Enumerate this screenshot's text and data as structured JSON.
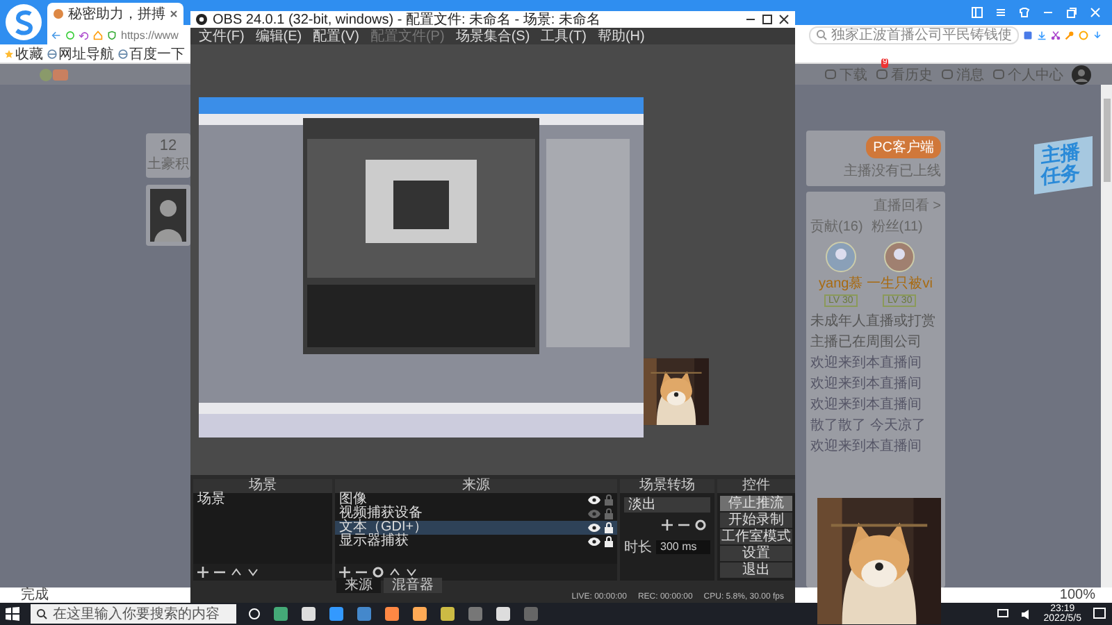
{
  "browser": {
    "tabs": [
      {
        "title": "秘密助力，拼搏",
        "selected": true
      }
    ],
    "address": "https://www",
    "search": {
      "placeholder": "独家正波首播公司平民铸钱使"
    },
    "bookmarks": [
      "收藏",
      "网址导航",
      "百度一下"
    ],
    "site_nav": [
      {
        "label": "下载"
      },
      {
        "label": "看历史",
        "badge": "9"
      },
      {
        "label": "消息"
      },
      {
        "label": "个人中心"
      }
    ],
    "score_card": {
      "value": "12",
      "label": "土豪积"
    },
    "side_panel": {
      "client_button": "PC客户端",
      "status": "主播没有已上线",
      "replay_link": "直播回看 >",
      "tabs": [
        {
          "label": "贡献(16)",
          "selected": false
        },
        {
          "label": "粉丝(11)",
          "selected": false
        }
      ],
      "fans": [
        {
          "name": "yang慕",
          "level": "LV 30"
        },
        {
          "name": "一生只被vi",
          "level": "LV 30"
        }
      ],
      "notice": [
        "未成年人直播或打赏",
        "主播已在周围公司"
      ],
      "chat": [
        "欢迎来到本直播间",
        "欢迎来到本直播间",
        "欢迎来到本直播间",
        "散了散了 今天凉了",
        "欢迎来到本直播间"
      ]
    },
    "promo": "主播任务",
    "status_text": "完成",
    "zoom": "100%"
  },
  "obs": {
    "title": "OBS 24.0.1 (32-bit, windows) - 配置文件: 未命名 - 场景: 未命名",
    "menu": [
      {
        "label": "文件(F)",
        "disabled": false
      },
      {
        "label": "编辑(E)",
        "disabled": false
      },
      {
        "label": "配置(V)",
        "disabled": false
      },
      {
        "label": "配置文件(P)",
        "disabled": true
      },
      {
        "label": "场景集合(S)",
        "disabled": false
      },
      {
        "label": "工具(T)",
        "disabled": false
      },
      {
        "label": "帮助(H)",
        "disabled": false
      }
    ],
    "scenes": {
      "title": "场景",
      "items": [
        {
          "label": "场景",
          "selected": false
        }
      ]
    },
    "sources": {
      "title": "来源",
      "items": [
        {
          "label": "图像",
          "visible": true,
          "locked": false,
          "selected": false
        },
        {
          "label": "视频捕获设备",
          "visible": false,
          "locked": false,
          "selected": false
        },
        {
          "label": "文本（GDI+）",
          "visible": true,
          "locked": true,
          "selected": true
        },
        {
          "label": "显示器捕获",
          "visible": true,
          "locked": true,
          "selected": false
        }
      ]
    },
    "transitions": {
      "title": "场景转场",
      "transition": "淡出",
      "duration_label": "时长",
      "duration": "300 ms"
    },
    "controls": {
      "title": "控件",
      "buttons": [
        {
          "label": "停止推流",
          "active": true
        },
        {
          "label": "开始录制",
          "active": false
        },
        {
          "label": "工作室模式",
          "active": false
        },
        {
          "label": "设置",
          "active": false
        },
        {
          "label": "退出",
          "active": false
        }
      ]
    },
    "bottom_tabs": [
      {
        "label": "来源",
        "selected": true
      },
      {
        "label": "混音器",
        "selected": false
      }
    ],
    "status": [
      "LIVE: 00:00:00",
      "REC: 00:00:00",
      "CPU: 5.8%, 30.00 fps"
    ]
  },
  "taskbar": {
    "search": {
      "placeholder": "在这里输入你要搜索的内容"
    },
    "time": "23:19",
    "date": "2022/5/5"
  }
}
